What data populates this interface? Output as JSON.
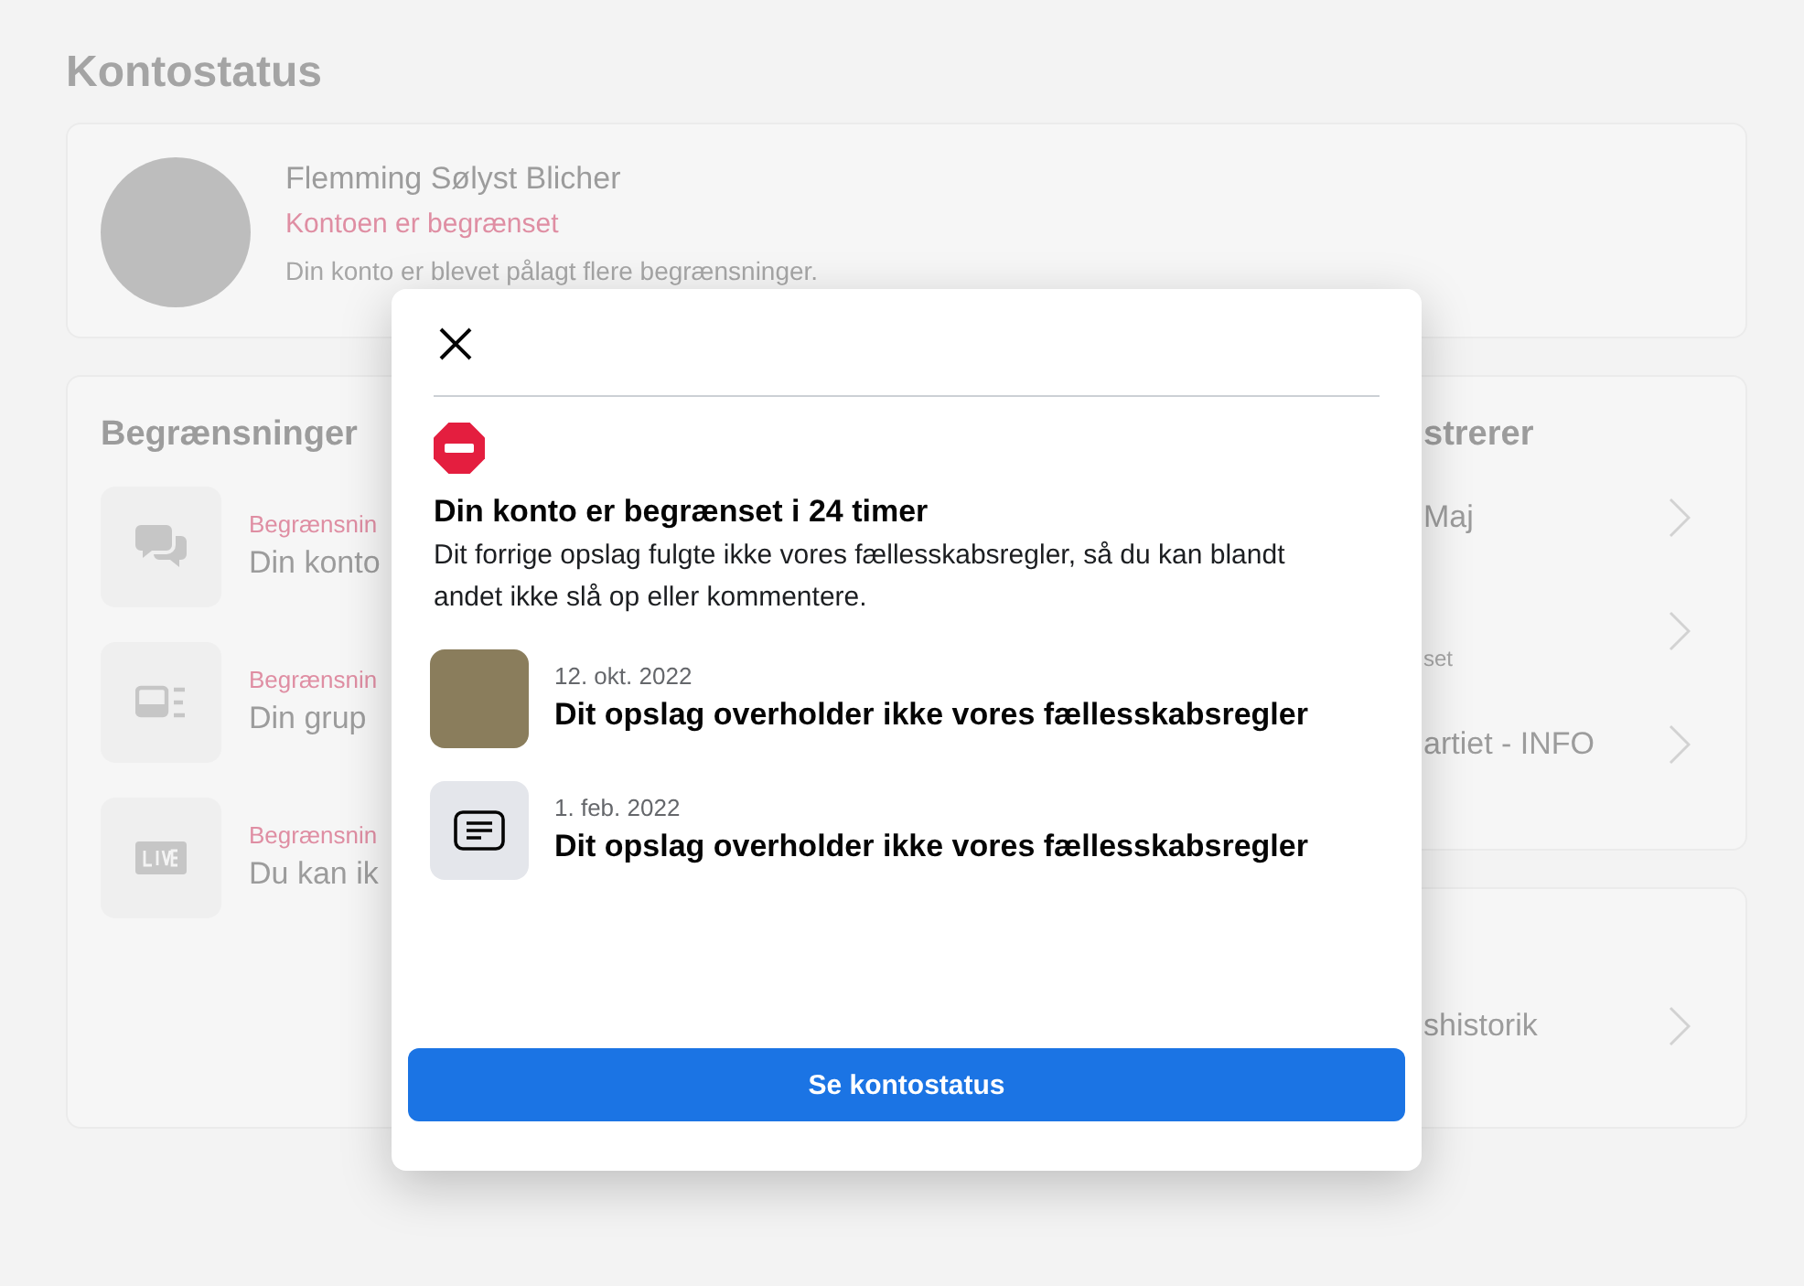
{
  "page": {
    "title": "Kontostatus"
  },
  "profile": {
    "name": "Flemming Sølyst Blicher",
    "status": "Kontoen er begrænset",
    "description": "Din konto er blevet pålagt flere begrænsninger."
  },
  "restrictions": {
    "heading": "Begrænsninger",
    "items": [
      {
        "kind": "chat",
        "label": "Begrænsnin",
        "title": "Din konto"
      },
      {
        "kind": "group",
        "label": "Begrænsnin",
        "title": "Din grup"
      },
      {
        "kind": "live",
        "label": "Begrænsnin",
        "title": "Du kan ik"
      }
    ]
  },
  "right_panel": {
    "heading": "strerer",
    "items": [
      {
        "title": "Maj"
      },
      {
        "label": "set"
      },
      {
        "title": "artiet - INFO"
      }
    ]
  },
  "history_panel": {
    "items": [
      {
        "title": "shistorik"
      }
    ]
  },
  "dialog": {
    "heading": "Din konto er begrænset i 24 timer",
    "body": "Dit forrige opslag fulgte ikke vores fællesskabsregler, så du kan blandt andet ikke slå op eller kommentere.",
    "posts": [
      {
        "kind": "photo",
        "date": "12. okt. 2022",
        "title": "Dit opslag overholder ikke vores fællesskabsregler"
      },
      {
        "kind": "text",
        "date": "1. feb. 2022",
        "title": "Dit opslag overholder ikke vores fællesskabsregler"
      }
    ],
    "button": "Se kontostatus"
  }
}
